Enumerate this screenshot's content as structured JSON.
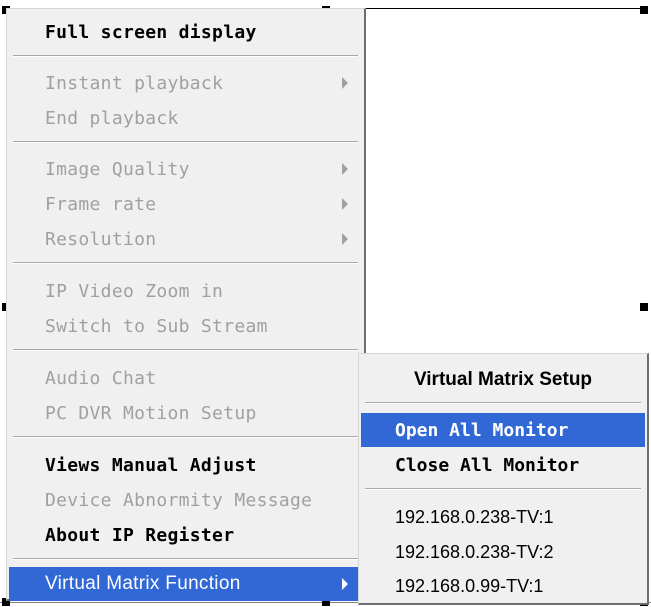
{
  "menu": {
    "items": [
      {
        "label": "Full screen display",
        "enabled": true,
        "arrow": false
      },
      {
        "label": "Instant playback",
        "enabled": false,
        "arrow": true
      },
      {
        "label": "End playback",
        "enabled": false,
        "arrow": false
      },
      {
        "label": "Image Quality",
        "enabled": false,
        "arrow": true
      },
      {
        "label": "Frame rate",
        "enabled": false,
        "arrow": true
      },
      {
        "label": "Resolution",
        "enabled": false,
        "arrow": true
      },
      {
        "label": "IP Video Zoom in",
        "enabled": false,
        "arrow": false
      },
      {
        "label": "Switch to Sub Stream",
        "enabled": false,
        "arrow": false
      },
      {
        "label": "Audio Chat",
        "enabled": false,
        "arrow": false
      },
      {
        "label": "PC DVR Motion Setup",
        "enabled": false,
        "arrow": false
      },
      {
        "label": "Views Manual Adjust",
        "enabled": true,
        "arrow": false
      },
      {
        "label": "Device Abnormity Message",
        "enabled": false,
        "arrow": false
      },
      {
        "label": "About IP Register",
        "enabled": true,
        "arrow": false
      },
      {
        "label": "Virtual Matrix Function",
        "enabled": true,
        "arrow": true,
        "selected": true
      }
    ]
  },
  "submenu": {
    "title": "Virtual Matrix Setup",
    "items": [
      {
        "label": "Open All Monitor",
        "selected": true
      },
      {
        "label": "Close All Monitor",
        "selected": false
      },
      {
        "label": "192.168.0.238-TV:1",
        "selected": false
      },
      {
        "label": "192.168.0.238-TV:2",
        "selected": false
      },
      {
        "label": "192.168.0.99-TV:1",
        "selected": false
      }
    ]
  },
  "colors": {
    "menu_bg": "#f0f0f0",
    "highlight": "#3168d5",
    "disabled_text": "#a0a0a0"
  }
}
